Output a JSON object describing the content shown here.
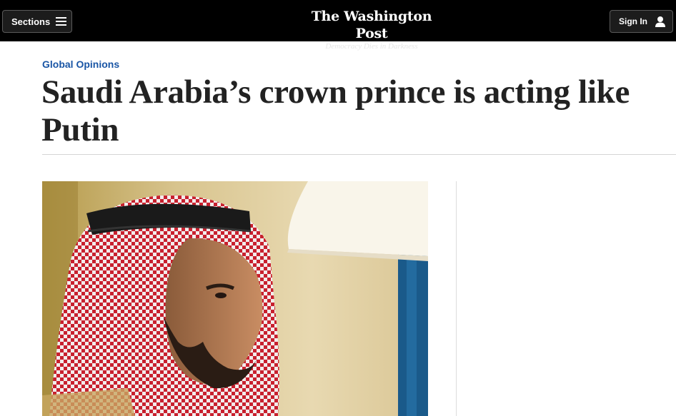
{
  "header": {
    "sections_label": "Sections",
    "logo_text": "The Washington Post",
    "tagline": "Democracy Dies in Darkness",
    "signin_label": "Sign In"
  },
  "article": {
    "kicker": "Global Opinions",
    "headline": "Saudi Arabia’s crown prince is acting like Putin"
  },
  "icons": {
    "menu": "hamburger-menu-icon",
    "user": "user-icon"
  },
  "colors": {
    "topbar": "#000000",
    "kicker": "#1955a5",
    "headline": "#222222"
  }
}
